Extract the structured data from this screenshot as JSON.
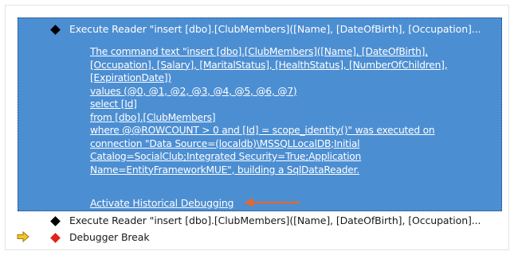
{
  "events": [
    {
      "text": "Execute Reader \"insert [dbo].[ClubMembers]([Name], [DateOfBirth], [Occupation]...",
      "icon": "black-diamond-icon",
      "selected": true
    },
    {
      "text": "Execute Reader \"insert [dbo].[ClubMembers]([Name], [DateOfBirth], [Occupation]...",
      "icon": "black-diamond-icon",
      "selected": false
    },
    {
      "text": "Debugger Break",
      "icon": "red-diamond-icon",
      "selected": false,
      "current": true
    }
  ],
  "detail_lines": [
    "The command text \"insert [dbo].[ClubMembers]([Name], [DateOfBirth],",
    "[Occupation], [Salary], [MaritalStatus], [HealthStatus], [NumberOfChildren],",
    "[ExpirationDate])",
    "values (@0, @1, @2, @3, @4, @5, @6, @7)",
    "select [Id]",
    "from [dbo].[ClubMembers]",
    "where @@ROWCOUNT > 0 and [Id] = scope_identity()\" was executed on",
    "connection \"Data Source=(localdb)\\MSSQLLocalDB;Initial",
    "Catalog=SocialClub;Integrated Security=True;Application",
    "Name=EntityFrameworkMUE\", building a SqlDataReader."
  ],
  "activate_link": "Activate Historical Debugging",
  "colors": {
    "selection": "#4c8ed2",
    "annotation_arrow": "#e8672b",
    "current_pointer": "#f3c81f",
    "break_diamond": "#e2231a"
  }
}
